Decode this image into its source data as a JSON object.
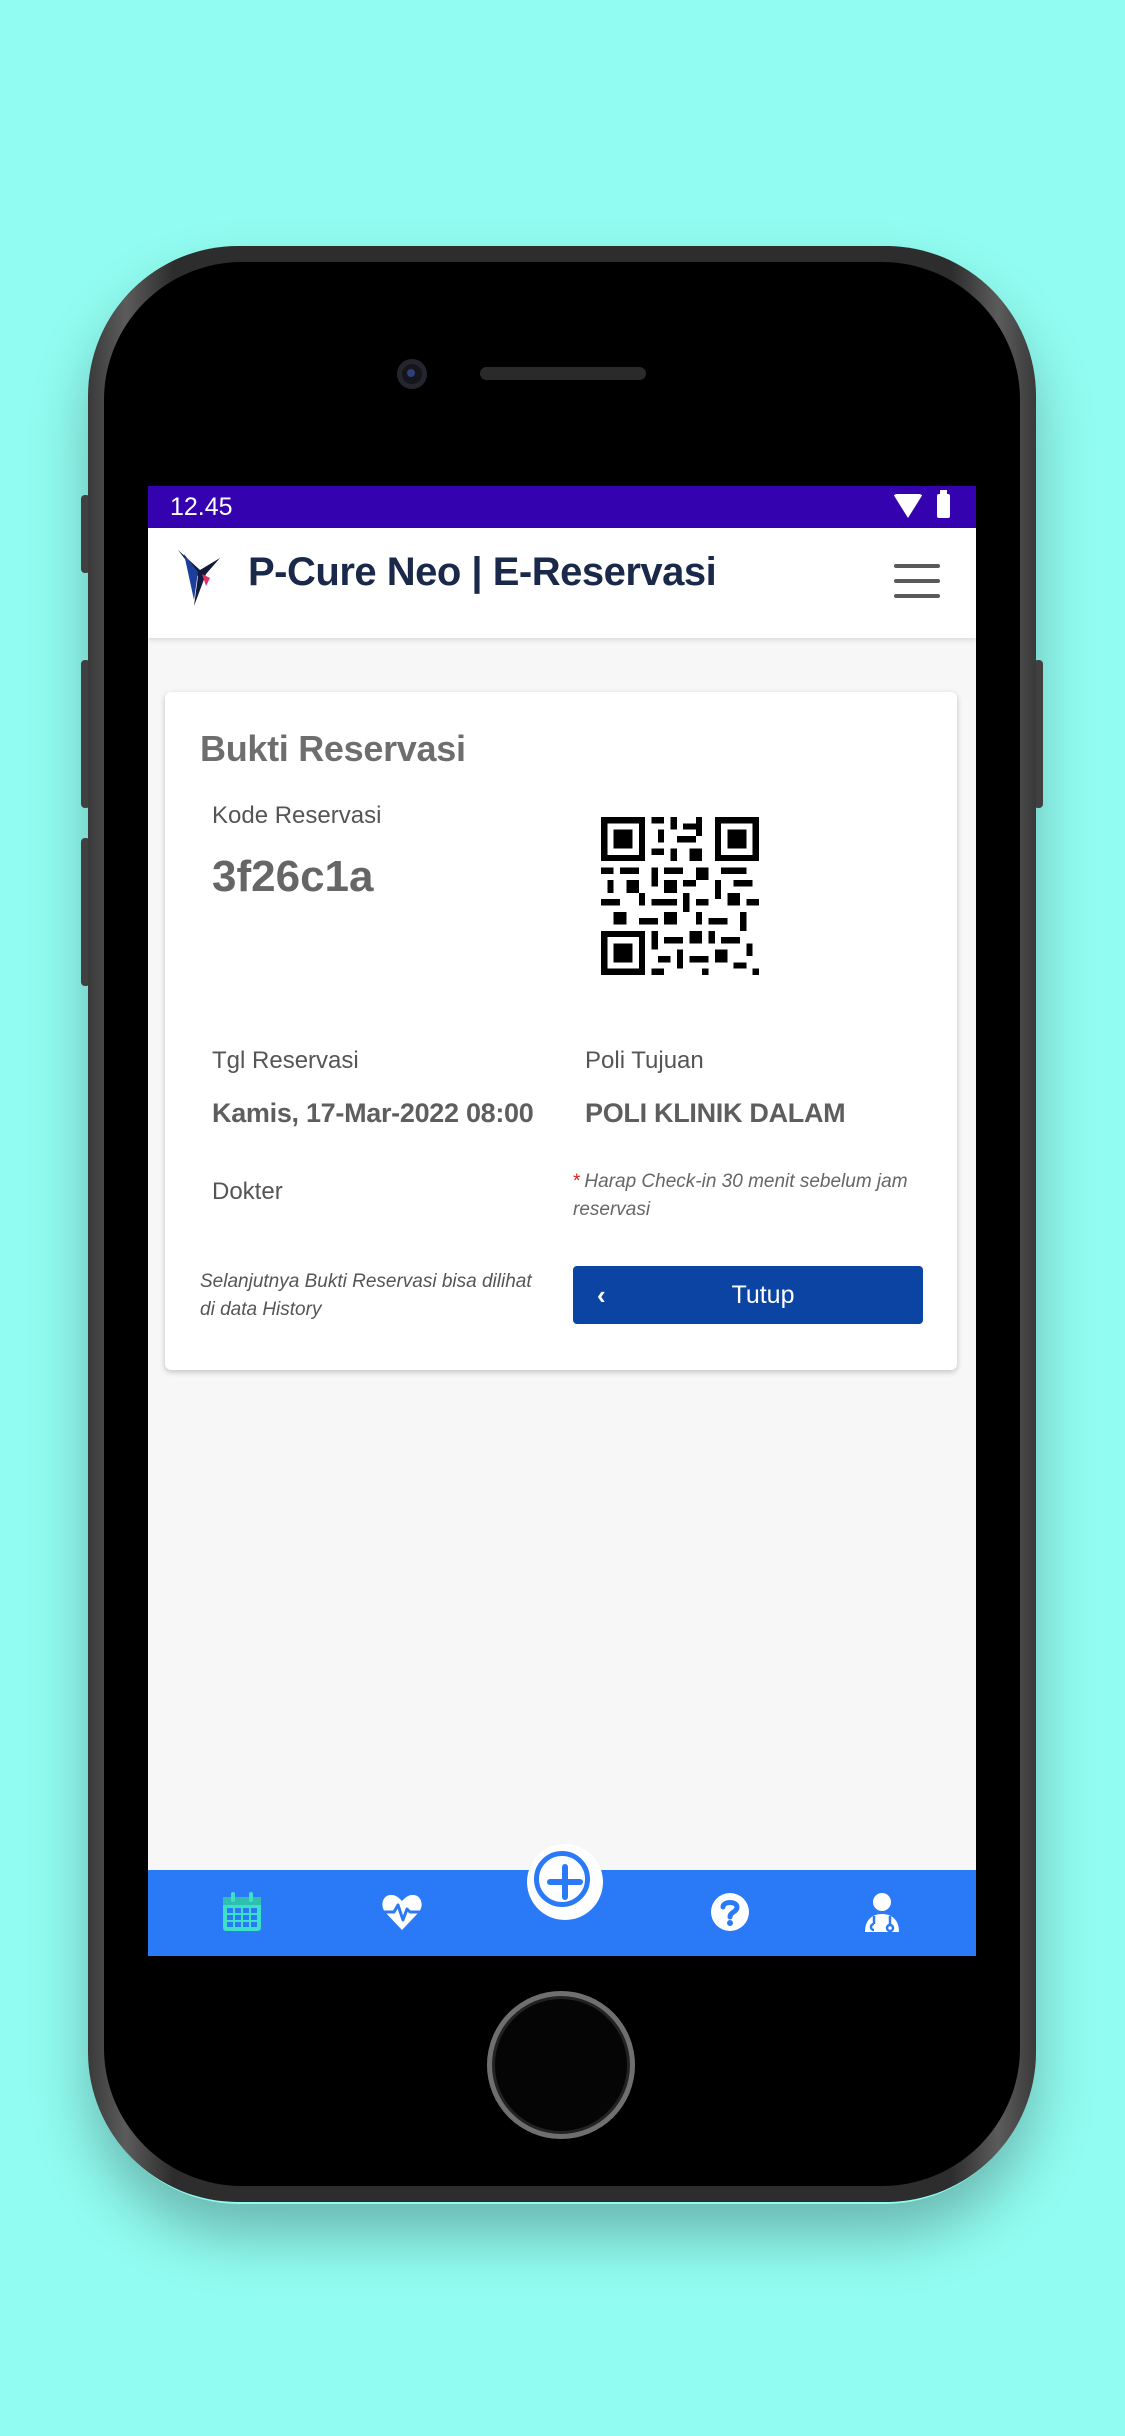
{
  "status_bar": {
    "time": "12.45"
  },
  "app_bar": {
    "title": "P-Cure Neo | E-Reservasi"
  },
  "card": {
    "title": "Bukti Reservasi",
    "kode_label": "Kode Reservasi",
    "kode_value": "3f26c1a",
    "tgl_label": "Tgl Reservasi",
    "tgl_value": "Kamis, 17-Mar-2022 08:00",
    "poli_label": "Poli Tujuan",
    "poli_value": "POLI KLINIK DALAM",
    "dokter_label": "Dokter",
    "dokter_value": "",
    "checkin_note": "Harap Check-in 30 menit sebelum jam reservasi",
    "checkin_note_marker": "*",
    "history_note": "Selanjutnya Bukti Reservasi bisa dilihat di data History",
    "close_button_label": "Tutup",
    "close_button_chevron": "‹"
  },
  "bottom_nav": {
    "items": [
      "calendar-icon",
      "heart-pulse-icon",
      "add-icon",
      "help-icon",
      "doctor-icon"
    ],
    "active": "calendar-icon",
    "active_color": "#3fe0c8",
    "bar_color": "#2a7af8"
  },
  "colors": {
    "status_bar": "#3502b0",
    "primary_button": "#0b44a3",
    "background": "#91fcf1"
  }
}
